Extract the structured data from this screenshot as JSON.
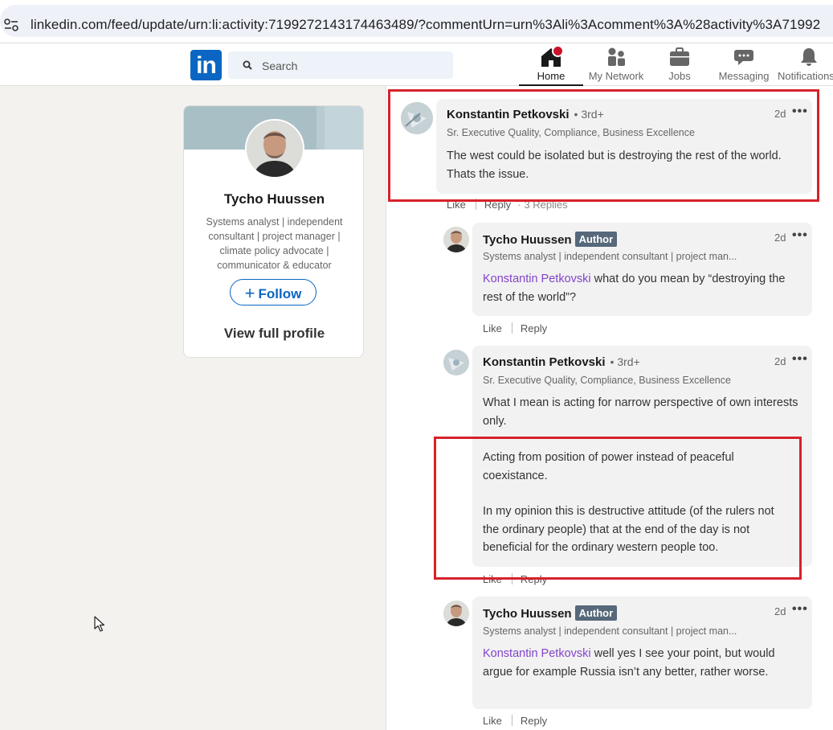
{
  "browser": {
    "url": "linkedin.com/feed/update/urn:li:activity:7199272143174463489/?commentUrn=urn%3Ali%3Acomment%3A%28activity%3A71992"
  },
  "nav": {
    "logo": "in",
    "search_placeholder": "Search",
    "items": [
      {
        "label": "Home",
        "icon": "home-icon",
        "notification": true
      },
      {
        "label": "My Network",
        "icon": "network-icon"
      },
      {
        "label": "Jobs",
        "icon": "briefcase-icon"
      },
      {
        "label": "Messaging",
        "icon": "messaging-icon"
      },
      {
        "label": "Notifications",
        "icon": "bell-icon"
      }
    ]
  },
  "profile": {
    "name": "Tycho Huussen",
    "headline": "Systems analyst | independent consultant | project manager | climate policy advocate | communicator & educator",
    "follow_label": "Follow",
    "view_profile_label": "View full profile"
  },
  "comments": {
    "c1": {
      "name": "Konstantin Petkovski",
      "degree": "• 3rd+",
      "subtitle": "Sr. Executive Quality, Compliance, Business Excellence",
      "time": "2d",
      "text": "The west could be isolated but is destroying the rest of the world. Thats the issue.",
      "like": "Like",
      "reply": "Reply",
      "replies": "3 Replies"
    },
    "r1": {
      "name": "Tycho Huussen",
      "badge": "Author",
      "subtitle": "Systems analyst | independent consultant | project man...",
      "time": "2d",
      "mention": "Konstantin Petkovski",
      "text": " what do you mean by “destroying the rest of the world”?",
      "like": "Like",
      "reply": "Reply"
    },
    "r2": {
      "name": "Konstantin Petkovski",
      "degree": "• 3rd+",
      "subtitle": "Sr. Executive Quality, Compliance, Business Excellence",
      "time": "2d",
      "p1": "What I mean is acting for narrow perspective of own interests only.",
      "p2": "Acting from position of power instead of peaceful coexistance.",
      "p3": "In my opinion this is destructive attitude (of the rulers not the ordinary people) that at the end of the day is not beneficial for the ordinary western people too.",
      "like": "Like",
      "reply": "Reply"
    },
    "r3": {
      "name": "Tycho Huussen",
      "badge": "Author",
      "subtitle": "Systems analyst | independent consultant | project man...",
      "time": "2d",
      "mention": "Konstantin Petkovski",
      "text": " well yes I see your point, but would argue for example Russia isn’t any better, rather worse.",
      "like": "Like",
      "reply": "Reply"
    }
  },
  "colors": {
    "linkedin_blue": "#0a66c2",
    "mention_purple": "#8344cc",
    "highlight_red": "#d6222a",
    "notification_red": "#cb112d"
  }
}
